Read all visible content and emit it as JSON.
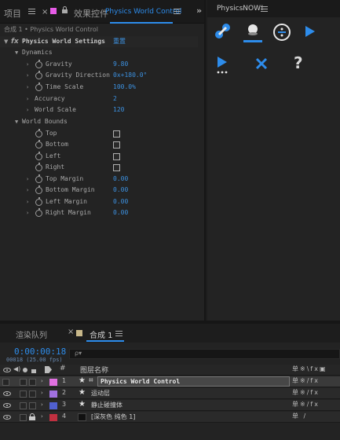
{
  "left_tabs": {
    "project_tab": "项目",
    "effects_tab_prefix": "效果控件",
    "effects_tab_name": "Physics World Control"
  },
  "effect_controls": {
    "breadcrumb": "合成 1 • Physics World Control",
    "effect_name": "Physics World Settings",
    "reset": "重置",
    "dynamics_label": "Dynamics",
    "gravity_label": "Gravity",
    "gravity_value": "9.80",
    "gravity_dir_label": "Gravity Direction",
    "gravity_dir_value": "0x+180.0°",
    "time_scale_label": "Time Scale",
    "time_scale_value": "100.0%",
    "accuracy_label": "Accuracy",
    "accuracy_value": "2",
    "world_scale_label": "World Scale",
    "world_scale_value": "120",
    "world_bounds_label": "World Bounds",
    "top_label": "Top",
    "bottom_label": "Bottom",
    "left_label": "Left",
    "right_label": "Right",
    "top_margin_label": "Top Margin",
    "top_margin_value": "0.00",
    "bottom_margin_label": "Bottom Margin",
    "bottom_margin_value": "0.00",
    "left_margin_label": "Left Margin",
    "left_margin_value": "0.00",
    "right_margin_label": "Right Margin",
    "right_margin_value": "0.00"
  },
  "physics_panel": {
    "title": "PhysicsNOW!",
    "help_glyph": "?"
  },
  "bottom": {
    "render_queue_tab": "渲染队列",
    "comp_tab": "合成 1",
    "timecode": "0:00:00:18",
    "timecode_sub": "00018 (25.00 fps)",
    "search_placeholder": "ρ▾",
    "col_hash": "#",
    "col_layer_name": "图层名称",
    "layers": [
      {
        "num": "1",
        "name": "Physics World Control",
        "color": "#e070e0"
      },
      {
        "num": "2",
        "name": "运动层",
        "color": "#a070e0"
      },
      {
        "num": "3",
        "name": "静止碰撞体",
        "color": "#5060d0"
      },
      {
        "num": "4",
        "name": "[深灰色 纯色 1]",
        "color": "#c03040"
      }
    ]
  },
  "colors": {
    "accent": "#2d8ceb",
    "value_blue": "#3c90df",
    "background": "#232323"
  },
  "icons": [
    "chain-link-icon",
    "ball-ground-icon",
    "divide-circle-icon",
    "play-icon",
    "play-more-icon",
    "close-x-icon",
    "help-icon",
    "fx-icon",
    "stopwatch-icon",
    "eye-icon",
    "lock-icon",
    "star-icon",
    "menu-icon"
  ]
}
